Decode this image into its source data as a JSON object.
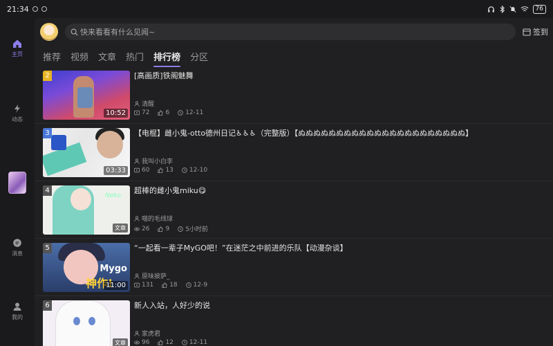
{
  "status_bar": {
    "time": "21:34",
    "battery": "76"
  },
  "sidebar": {
    "items": [
      {
        "label": "主页",
        "icon": "home-icon",
        "active": true
      },
      {
        "label": "动态",
        "icon": "lightning-icon",
        "active": false
      },
      {
        "label": "消息",
        "icon": "message-icon",
        "active": false
      },
      {
        "label": "我的",
        "icon": "person-icon",
        "active": false
      }
    ]
  },
  "header": {
    "search_placeholder": "快来看看有什么见闻~",
    "checkin_label": "签到"
  },
  "tabs": [
    {
      "label": "推荐",
      "active": false
    },
    {
      "label": "视频",
      "active": false
    },
    {
      "label": "文章",
      "active": false
    },
    {
      "label": "热门",
      "active": false
    },
    {
      "label": "排行榜",
      "active": true
    },
    {
      "label": "分区",
      "active": false
    }
  ],
  "ranking": [
    {
      "rank": "2",
      "title": "[高画质]铁阁魅舞",
      "author": "清醒",
      "views": "72",
      "likes": "6",
      "time": "12-11",
      "duration": "10:52",
      "type": "video"
    },
    {
      "rank": "3",
      "title": "【电棍】雌小鬼-otto德州日记♿♿♿（完整版）【ぬぬぬぬぬぬぬぬぬぬぬぬぬぬぬぬぬぬぬぬぬぬ】",
      "author": "我叫小白李",
      "views": "60",
      "likes": "13",
      "time": "12-10",
      "duration": "03:33",
      "type": "video"
    },
    {
      "rank": "4",
      "title": "超棒的雌小鬼miku😋",
      "author": "喵的毛线球",
      "views": "26",
      "likes": "9",
      "time": "5小时前",
      "duration": "文章",
      "type": "article"
    },
    {
      "rank": "5",
      "title": "“一起看一辈子MyGO吧！”在迷茫之中前进的乐队【动漫杂谈】",
      "author": "原味披萨_",
      "views": "131",
      "likes": "18",
      "time": "12-9",
      "duration": "11:00",
      "type": "video"
    },
    {
      "rank": "6",
      "title": "新人入站，人好少的说",
      "author": "家虎君",
      "views": "96",
      "likes": "12",
      "time": "12-11",
      "duration": "文章",
      "type": "article"
    }
  ],
  "thumb_text": {
    "mygo": "Mygo",
    "shen": "神作!",
    "neko": "Neko"
  },
  "colors": {
    "accent": "#8c7ee8",
    "rank_gold": "#e8b523",
    "rank_blue": "#4a78d8"
  }
}
